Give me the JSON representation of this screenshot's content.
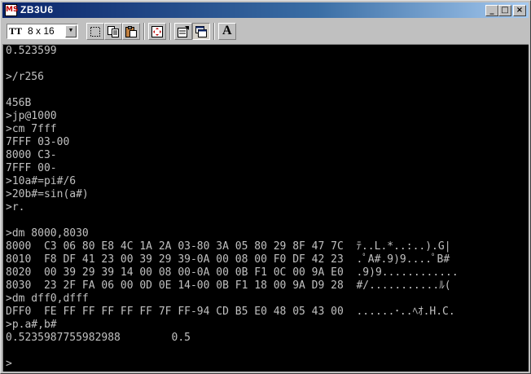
{
  "window": {
    "title": "ZB3U6",
    "app_icon_label": "MS",
    "minimize_label": "_",
    "maximize_label": "□",
    "close_label": "×",
    "titlebar_color": "#0a246a"
  },
  "toolbar": {
    "font_icon": "TT",
    "font_size_value": "8 x 16",
    "dropdown_icon": "▼",
    "buttons": [
      {
        "name": "select-icon"
      },
      {
        "name": "copy-icon"
      },
      {
        "name": "paste-icon"
      },
      {
        "name": "fullscreen-icon"
      },
      {
        "name": "properties-icon"
      },
      {
        "name": "background-icon"
      },
      {
        "name": "font-icon",
        "label": "A"
      }
    ]
  },
  "console": {
    "lines": [
      "0.523599",
      "",
      ">/r256",
      "",
      "456B",
      ">jp@1000",
      ">cm 7fff",
      "7FFF 03-00",
      "8000 C3-",
      "7FFF 00-",
      ">10a#=pi#/6",
      ">20b#=sin(a#)",
      ">r.",
      "",
      ">dm 8000,8030",
      "8000  C3 06 80 E8 4C 1A 2A 03-80 3A 05 80 29 8F 47 7C  ﾃ..L.*..:..).G|",
      "8010  F8 DF 41 23 00 39 29 39-0A 00 08 00 F0 DF 42 23  .ﾟA#.9)9....ﾟB#",
      "8020  00 39 29 39 14 00 08 00-0A 00 0B F1 0C 00 9A E0  .9)9............",
      "8030  23 2F FA 06 00 0D 0E 14-00 0B F1 18 00 9A D9 28  #/...........ﾙ(",
      ">dm dff0,dfff",
      "DFF0  FE FF FF FF FF FF 7F FF-94 CD B5 E0 48 05 43 00  ......･..ﾍｵ.H.C.",
      ">p.a#,b#",
      "0.5235987755982988        0.5",
      "",
      "",
      ">"
    ]
  }
}
